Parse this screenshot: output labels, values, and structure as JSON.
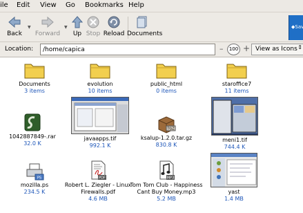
{
  "menubar": {
    "items": [
      "ile",
      "Edit",
      "View",
      "Go",
      "Bookmarks",
      "Help"
    ]
  },
  "toolbar": {
    "back": "Back",
    "forward": "Forward",
    "up": "Up",
    "stop": "Stop",
    "reload": "Reload",
    "documents": "Documents",
    "throbber": "◆Sav"
  },
  "location": {
    "label": "Location:",
    "value": "/home/capica",
    "zoom": "100",
    "view_mode": "View as Icons"
  },
  "files": [
    {
      "name": "Documents",
      "info": "3 items",
      "kind": "folder"
    },
    {
      "name": "evolution",
      "info": "10 items",
      "kind": "folder"
    },
    {
      "name": "public_html",
      "info": "0 items",
      "kind": "folder"
    },
    {
      "name": "staroffice7",
      "info": "11 items",
      "kind": "folder"
    },
    {
      "name": "1042887849-.rar",
      "info": "32.0 K",
      "kind": "rar"
    },
    {
      "name": "javaapps.tif",
      "info": "992.1 K",
      "kind": "image"
    },
    {
      "name": "ksalup-1.2.0.tar.gz",
      "info": "830.8 K",
      "kind": "tgz"
    },
    {
      "name": "meni1.tif",
      "info": "744.4 K",
      "kind": "image"
    },
    {
      "name": "mozilla.ps",
      "info": "234.5 K",
      "kind": "ps"
    },
    {
      "name": "Robert L. Ziegler - Linux Firewalls.pdf",
      "info": "4.6 MB",
      "kind": "pdf"
    },
    {
      "name": "Tom Tom Club - Happiness Cant Buy Money.mp3",
      "info": "5.2 MB",
      "kind": "mp3"
    },
    {
      "name": "yast",
      "info": "1.4 MB",
      "kind": "image"
    }
  ],
  "icon_labels": {
    "tgz": "TGZ",
    "ps": "PS",
    "pdf": "PDF",
    "mp3": "MP3"
  },
  "colors": {
    "folder": "#f2cf4e",
    "info_text": "#1c55b8",
    "toolbar_bg": "#edeae5"
  }
}
